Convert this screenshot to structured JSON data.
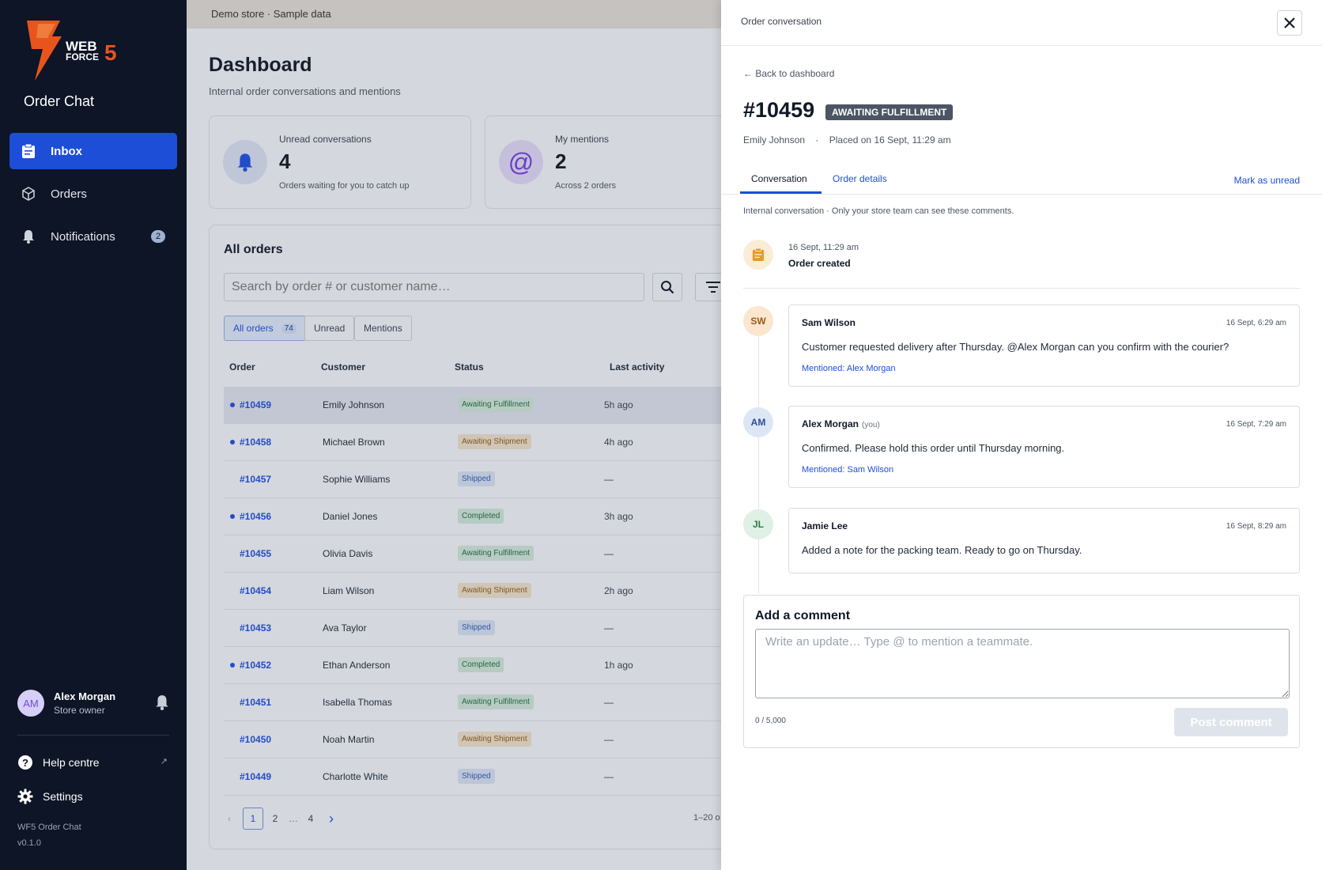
{
  "sidebar": {
    "logo_text": "WEB FORCE 5",
    "app_title": "Order Chat",
    "nav": [
      {
        "label": "Inbox",
        "icon": "clipboard-icon"
      },
      {
        "label": "Orders",
        "icon": "box-icon"
      },
      {
        "label": "Notifications",
        "icon": "bell-icon",
        "badge": "2"
      }
    ],
    "user": {
      "initials": "AM",
      "name": "Alex Morgan",
      "role": "Store owner"
    },
    "links": [
      {
        "label": "Help centre",
        "icon": "help-icon",
        "external": "↗"
      },
      {
        "label": "Settings",
        "icon": "gear-icon"
      }
    ],
    "app_name": "WF5 Order Chat",
    "version": "v0.1.0"
  },
  "banner": "Demo store · Sample data",
  "dashboard": {
    "title": "Dashboard",
    "subtitle": "Internal order conversations and mentions",
    "stats": [
      {
        "label": "Unread conversations",
        "value": "4",
        "desc": "Orders waiting for you to catch up"
      },
      {
        "label": "My mentions",
        "value": "2",
        "desc": "Across 2 orders",
        "icon_glyph": "@"
      }
    ]
  },
  "orders": {
    "title": "All orders",
    "search_placeholder": "Search by order # or customer name…",
    "chips": [
      {
        "label": "All orders",
        "count": "74"
      },
      {
        "label": "Unread"
      },
      {
        "label": "Mentions"
      }
    ],
    "columns": [
      "Order",
      "Customer",
      "Status",
      "Last activity"
    ],
    "rows": [
      {
        "id": "#10459",
        "customer": "Emily Johnson",
        "status": "Awaiting Fulfillment",
        "activity": "5h ago"
      },
      {
        "id": "#10458",
        "customer": "Michael Brown",
        "status": "Awaiting Shipment",
        "activity": "4h ago"
      },
      {
        "id": "#10457",
        "customer": "Sophie Williams",
        "status": "Shipped",
        "activity": "—"
      },
      {
        "id": "#10456",
        "customer": "Daniel Jones",
        "status": "Completed",
        "activity": "3h ago"
      },
      {
        "id": "#10455",
        "customer": "Olivia Davis",
        "status": "Awaiting Fulfillment",
        "activity": "—"
      },
      {
        "id": "#10454",
        "customer": "Liam Wilson",
        "status": "Awaiting Shipment",
        "activity": "2h ago"
      },
      {
        "id": "#10453",
        "customer": "Ava Taylor",
        "status": "Shipped",
        "activity": "—"
      },
      {
        "id": "#10452",
        "customer": "Ethan Anderson",
        "status": "Completed",
        "activity": "1h ago"
      },
      {
        "id": "#10451",
        "customer": "Isabella Thomas",
        "status": "Awaiting Fulfillment",
        "activity": "—"
      },
      {
        "id": "#10450",
        "customer": "Noah Martin",
        "status": "Awaiting Shipment",
        "activity": "—"
      },
      {
        "id": "#10449",
        "customer": "Charlotte White",
        "status": "Shipped",
        "activity": "—"
      }
    ],
    "pagination": {
      "prev": "‹",
      "pages": [
        "1",
        "2",
        "…",
        "4"
      ],
      "next": "›",
      "range": "1–20 o"
    }
  },
  "panel": {
    "header_title": "Order conversation",
    "back_label": "← Back to dashboard",
    "order_number": "#10459",
    "order_status": "AWAITING FULFILLMENT",
    "customer": "Emily Johnson",
    "separator": "·",
    "placed": "Placed on 16 Sept, 11:29 am",
    "tabs": [
      "Conversation",
      "Order details"
    ],
    "mark_unread": "Mark as unread",
    "internal_note": "Internal conversation · Only your store team can see these comments.",
    "event": {
      "time": "16 Sept, 11:29 am",
      "title": "Order created"
    },
    "comments": [
      {
        "initials": "SW",
        "name": "Sam Wilson",
        "you": "",
        "time": "16 Sept, 6:29 am",
        "text": "Customer requested delivery after Thursday. @Alex Morgan can you confirm with the courier?",
        "mention": "Mentioned: Alex Morgan"
      },
      {
        "initials": "AM",
        "name": "Alex Morgan",
        "you": "(you)",
        "time": "16 Sept, 7:29 am",
        "text": "Confirmed. Please hold this order until Thursday morning.",
        "mention": "Mentioned: Sam Wilson"
      },
      {
        "initials": "JL",
        "name": "Jamie Lee",
        "you": "",
        "time": "16 Sept, 8:29 am",
        "text": "Added a note for the packing team. Ready to go on Thursday.",
        "mention": ""
      }
    ],
    "add_comment": {
      "title": "Add a comment",
      "placeholder": "Write an update… Type @ to mention a teammate.",
      "count": "0 / 5,000",
      "button": "Post comment"
    }
  },
  "colors": {
    "accent": "#1d4ed8",
    "sidebar_bg": "#0d1526",
    "logo_orange": "#e8541e"
  }
}
